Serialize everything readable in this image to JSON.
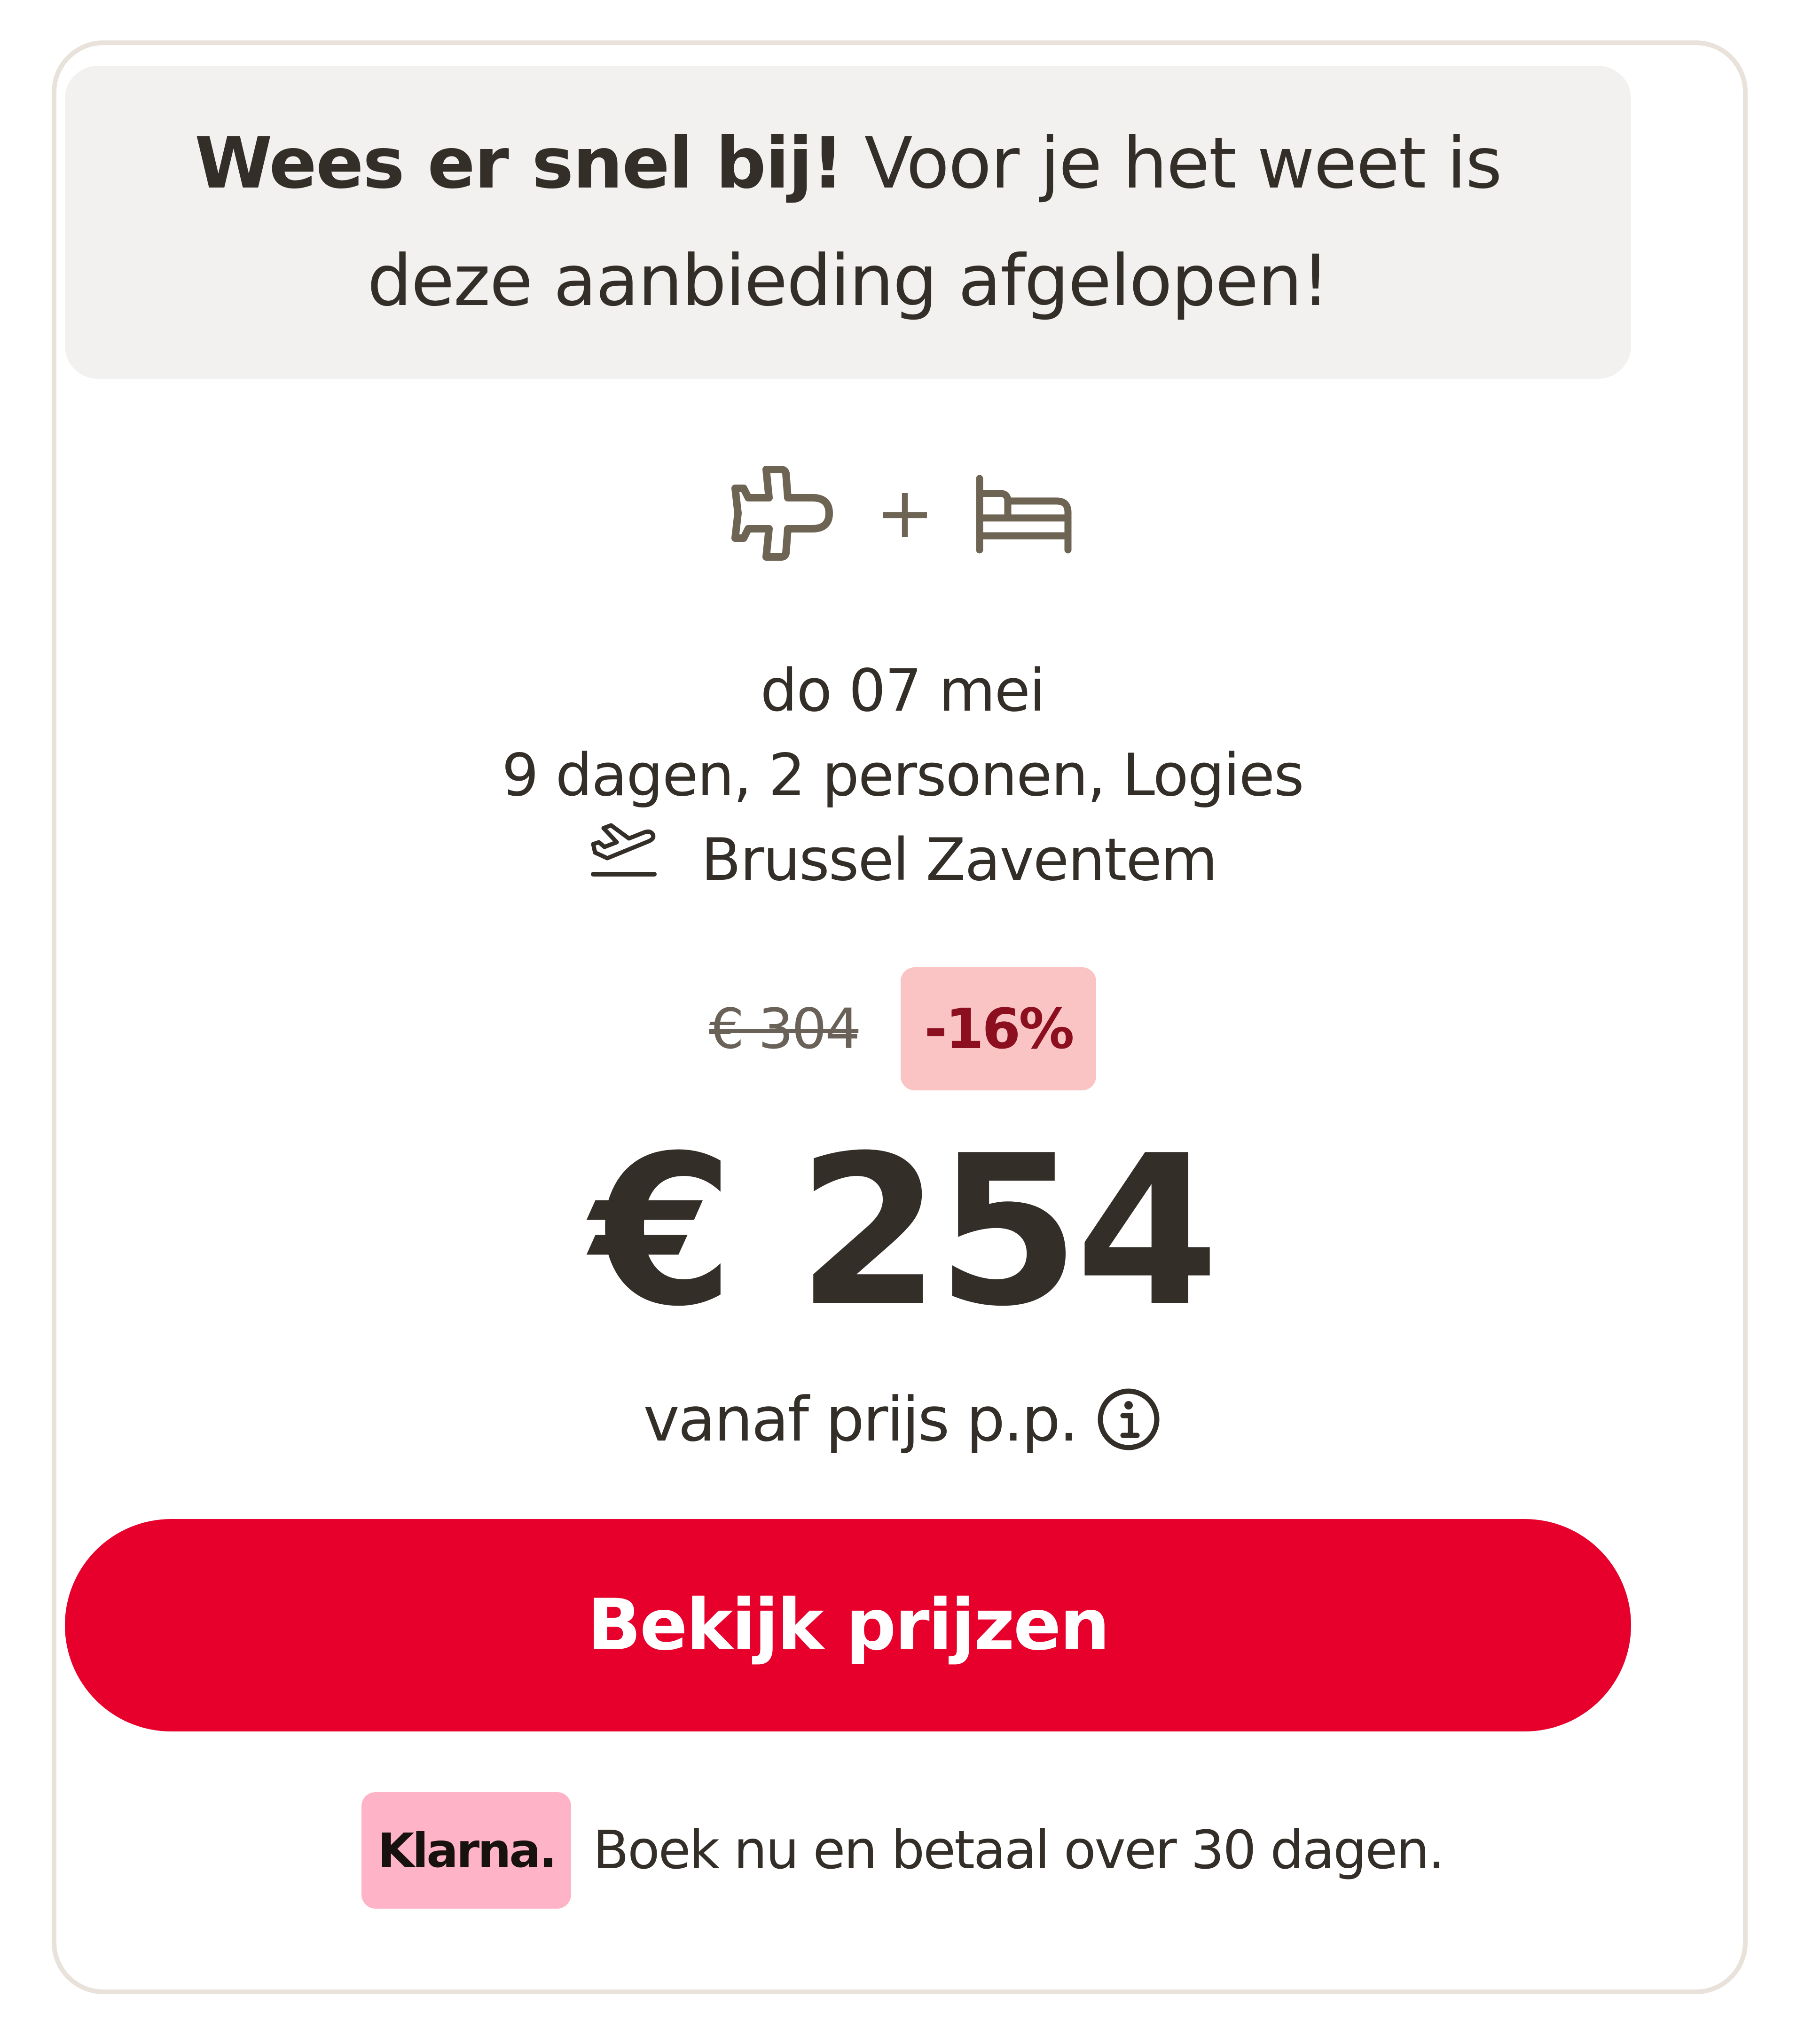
{
  "urgency": {
    "strong": "Wees er snel bij!",
    "rest": " Voor je het weet is deze aanbieding afgelopen!"
  },
  "icons": {
    "flight": "airplane-icon",
    "plus": "+",
    "hotel": "bed-icon"
  },
  "trip": {
    "date": "do 07 mei",
    "summary": "9 dagen, 2 personen, Logies",
    "airport": "Brussel Zaventem",
    "airport_icon": "departure-icon"
  },
  "pricing": {
    "old_price": "€ 304",
    "discount": "-16%",
    "price": "€ 254",
    "price_label": "vanaf prijs p.p.",
    "info_icon": "info-icon"
  },
  "cta": {
    "label": "Bekijk prijzen"
  },
  "klarna": {
    "logo": "Klarna.",
    "text": "Boek nu en betaal over 30 dagen."
  },
  "colors": {
    "accent": "#e8002d",
    "discount_bg": "#fbc4c4",
    "discount_text": "#8b0f1f",
    "klarna_bg": "#ffb3c7",
    "text": "#332e28",
    "banner_bg": "#f3f1ef",
    "card_border": "#e8e2da"
  }
}
